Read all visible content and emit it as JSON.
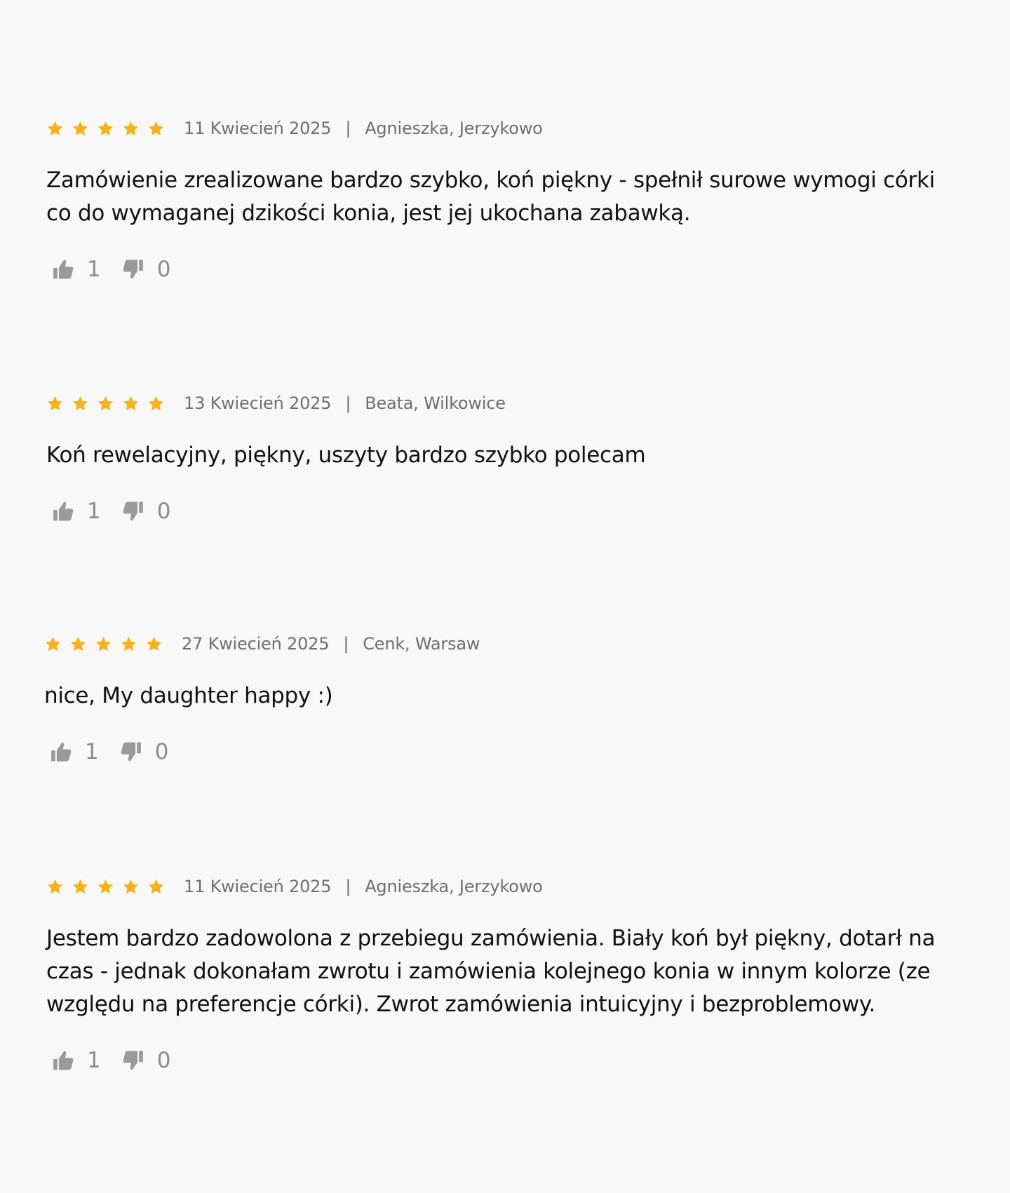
{
  "colors": {
    "star": "#f7b21b",
    "meta_text": "#6f6f6f",
    "vote_icon": "#9a9a9a",
    "background": "#f8f8f8"
  },
  "icons": {
    "star": "star-icon",
    "up": "thumbs-up-icon",
    "down": "thumbs-down-icon"
  },
  "reviews": [
    {
      "rating": 5,
      "date": "11 Kwiecień 2025",
      "separator": "|",
      "author": "Agnieszka, Jerzykowo",
      "text": "Zamówienie zrealizowane bardzo szybko, koń piękny - spełnił surowe wymogi córki co do wymaganej dzikości konia, jest jej ukochana zabawką.",
      "likes": "1",
      "dislikes": "0"
    },
    {
      "rating": 5,
      "date": "13 Kwiecień 2025",
      "separator": "|",
      "author": "Beata, Wilkowice",
      "text": "Koń rewelacyjny, piękny, uszyty bardzo szybko polecam",
      "likes": "1",
      "dislikes": "0"
    },
    {
      "rating": 5,
      "date": "27 Kwiecień 2025",
      "separator": "|",
      "author": "Cenk, Warsaw",
      "text": "nice, My daughter happy :)",
      "likes": "1",
      "dislikes": "0"
    },
    {
      "rating": 5,
      "date": "11 Kwiecień 2025",
      "separator": "|",
      "author": "Agnieszka, Jerzykowo",
      "text": "Jestem bardzo zadowolona z przebiegu zamówienia. Biały koń był piękny, dotarł na czas - jednak dokonałam zwrotu i zamówienia kolejnego konia w innym kolorze (ze względu na preferencje córki). Zwrot zamówienia intuicyjny i bezproblemowy.",
      "likes": "1",
      "dislikes": "0"
    }
  ]
}
